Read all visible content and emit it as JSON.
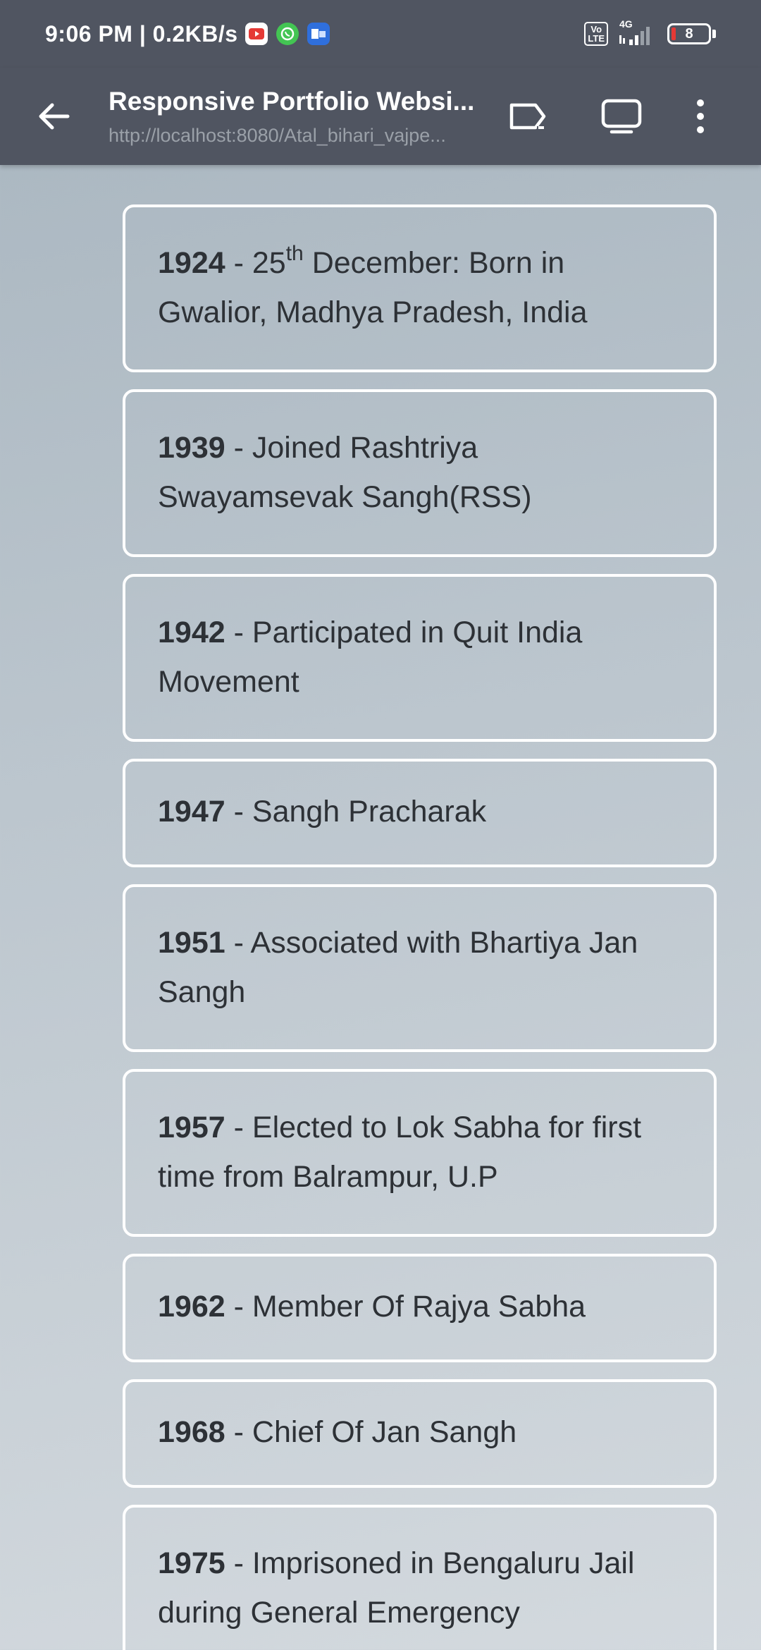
{
  "status_bar": {
    "time": "9:06 PM | 0.2KB/s",
    "network": "4G",
    "volte_top": "Vo",
    "volte_bottom": "LTE",
    "battery": "8",
    "apps": [
      "youtube-icon",
      "whatsapp-icon",
      "outlook-icon"
    ]
  },
  "toolbar": {
    "title": "Responsive Portfolio Websi...",
    "url": "http://localhost:8080/Atal_bihari_vajpe...",
    "icons": [
      "back-arrow-icon",
      "cast-icon",
      "desktop-view-icon",
      "more-vert-icon"
    ]
  },
  "timeline": [
    {
      "year": "1924",
      "prefix": " - 25",
      "sup": "th",
      "text": " December: Born in Gwalior, Madhya Pradesh, India"
    },
    {
      "year": "1939",
      "text": " - Joined Rashtriya Swayamsevak Sangh(RSS)"
    },
    {
      "year": "1942",
      "text": " - Participated in Quit India Movement"
    },
    {
      "year": "1947",
      "text": " - Sangh Pracharak"
    },
    {
      "year": "1951",
      "text": " - Associated with Bhartiya Jan Sangh"
    },
    {
      "year": "1957",
      "text": " - Elected to Lok Sabha for first time from Balrampur, U.P"
    },
    {
      "year": "1962",
      "text": " - Member Of Rajya Sabha"
    },
    {
      "year": "1968",
      "text": " - Chief Of Jan Sangh"
    },
    {
      "year": "1975",
      "text": " - Imprisoned in Bengaluru Jail during General Emergency"
    }
  ]
}
